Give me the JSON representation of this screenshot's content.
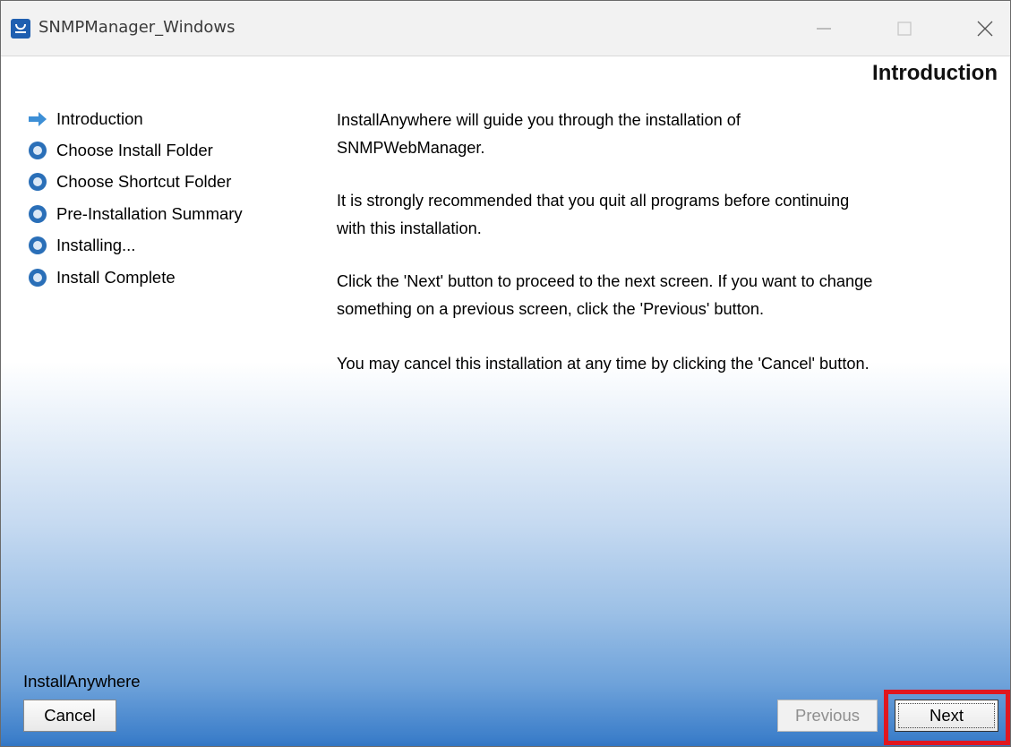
{
  "window": {
    "title": "SNMPManager_Windows",
    "icon": "installanywhere-app-icon"
  },
  "header": {
    "title": "Introduction"
  },
  "steps": [
    {
      "label": "Introduction",
      "state": "current",
      "icon": "arrow-right-icon"
    },
    {
      "label": "Choose Install Folder",
      "state": "pending",
      "icon": "circle-bullet-icon"
    },
    {
      "label": "Choose Shortcut Folder",
      "state": "pending",
      "icon": "circle-bullet-icon"
    },
    {
      "label": "Pre-Installation Summary",
      "state": "pending",
      "icon": "circle-bullet-icon"
    },
    {
      "label": "Installing...",
      "state": "pending",
      "icon": "circle-bullet-icon"
    },
    {
      "label": "Install Complete",
      "state": "pending",
      "icon": "circle-bullet-icon"
    }
  ],
  "intro": {
    "p1_line1": "InstallAnywhere will guide you through the installation of",
    "p1_line2": "SNMPWebManager.",
    "p2_line1": "It is strongly recommended that you quit all programs before continuing",
    "p2_line2": "with this installation.",
    "p3_line1": "Click the 'Next' button to proceed to the next screen. If you want to change",
    "p3_line2": "something on a previous screen, click the 'Previous' button.",
    "p4_line1": "You may cancel this installation at any time by clicking the 'Cancel' button."
  },
  "footer": {
    "brand": "InstallAnywhere",
    "cancel_label": "Cancel",
    "previous_label": "Previous",
    "next_label": "Next",
    "previous_enabled": false
  },
  "colors": {
    "accent_blue": "#2f74c2",
    "highlight_red": "#e0171f"
  }
}
